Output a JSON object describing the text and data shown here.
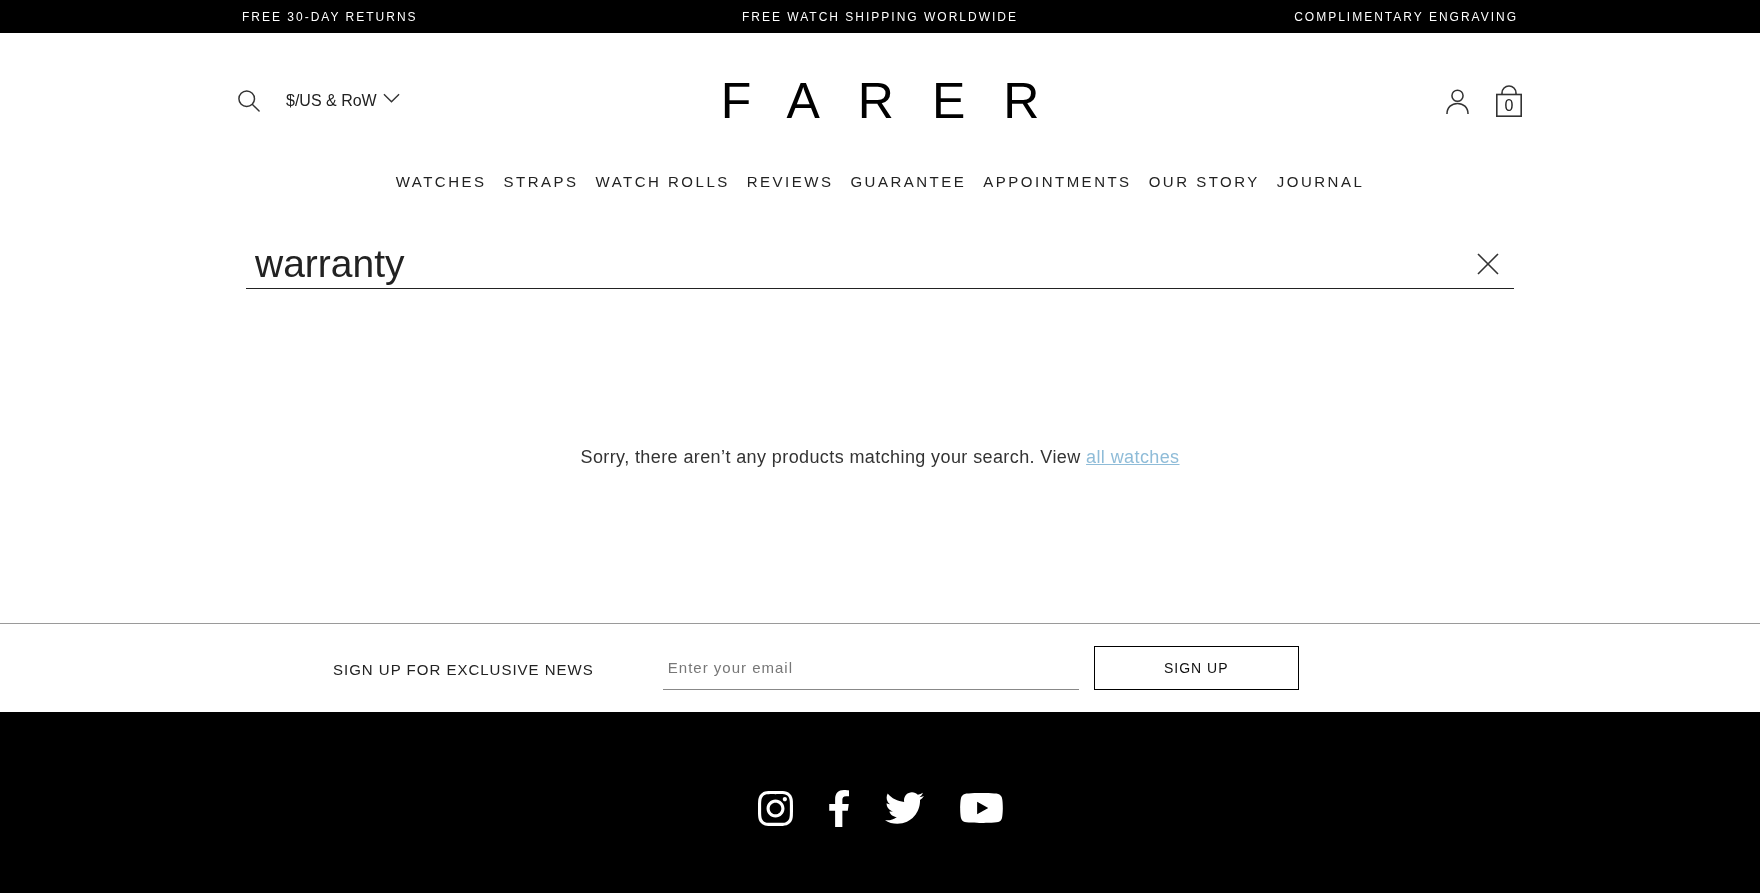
{
  "announcement_bar": {
    "items": [
      "FREE 30-DAY RETURNS",
      "FREE WATCH SHIPPING WORLDWIDE",
      "COMPLIMENTARY ENGRAVING"
    ]
  },
  "header": {
    "currency": "$/US & RoW",
    "logo": "FARER",
    "cart_count": "0"
  },
  "nav": {
    "items": [
      "WATCHES",
      "STRAPS",
      "WATCH ROLLS",
      "REVIEWS",
      "GUARANTEE",
      "APPOINTMENTS",
      "OUR STORY",
      "JOURNAL"
    ]
  },
  "search": {
    "value": "warranty"
  },
  "results": {
    "message": "Sorry, there aren’t any products matching your search. View",
    "link": "all watches"
  },
  "newsletter": {
    "label": "SIGN UP FOR EXCLUSIVE NEWS",
    "email": {
      "placeholder": "Enter your email"
    },
    "button": "SIGN UP"
  }
}
